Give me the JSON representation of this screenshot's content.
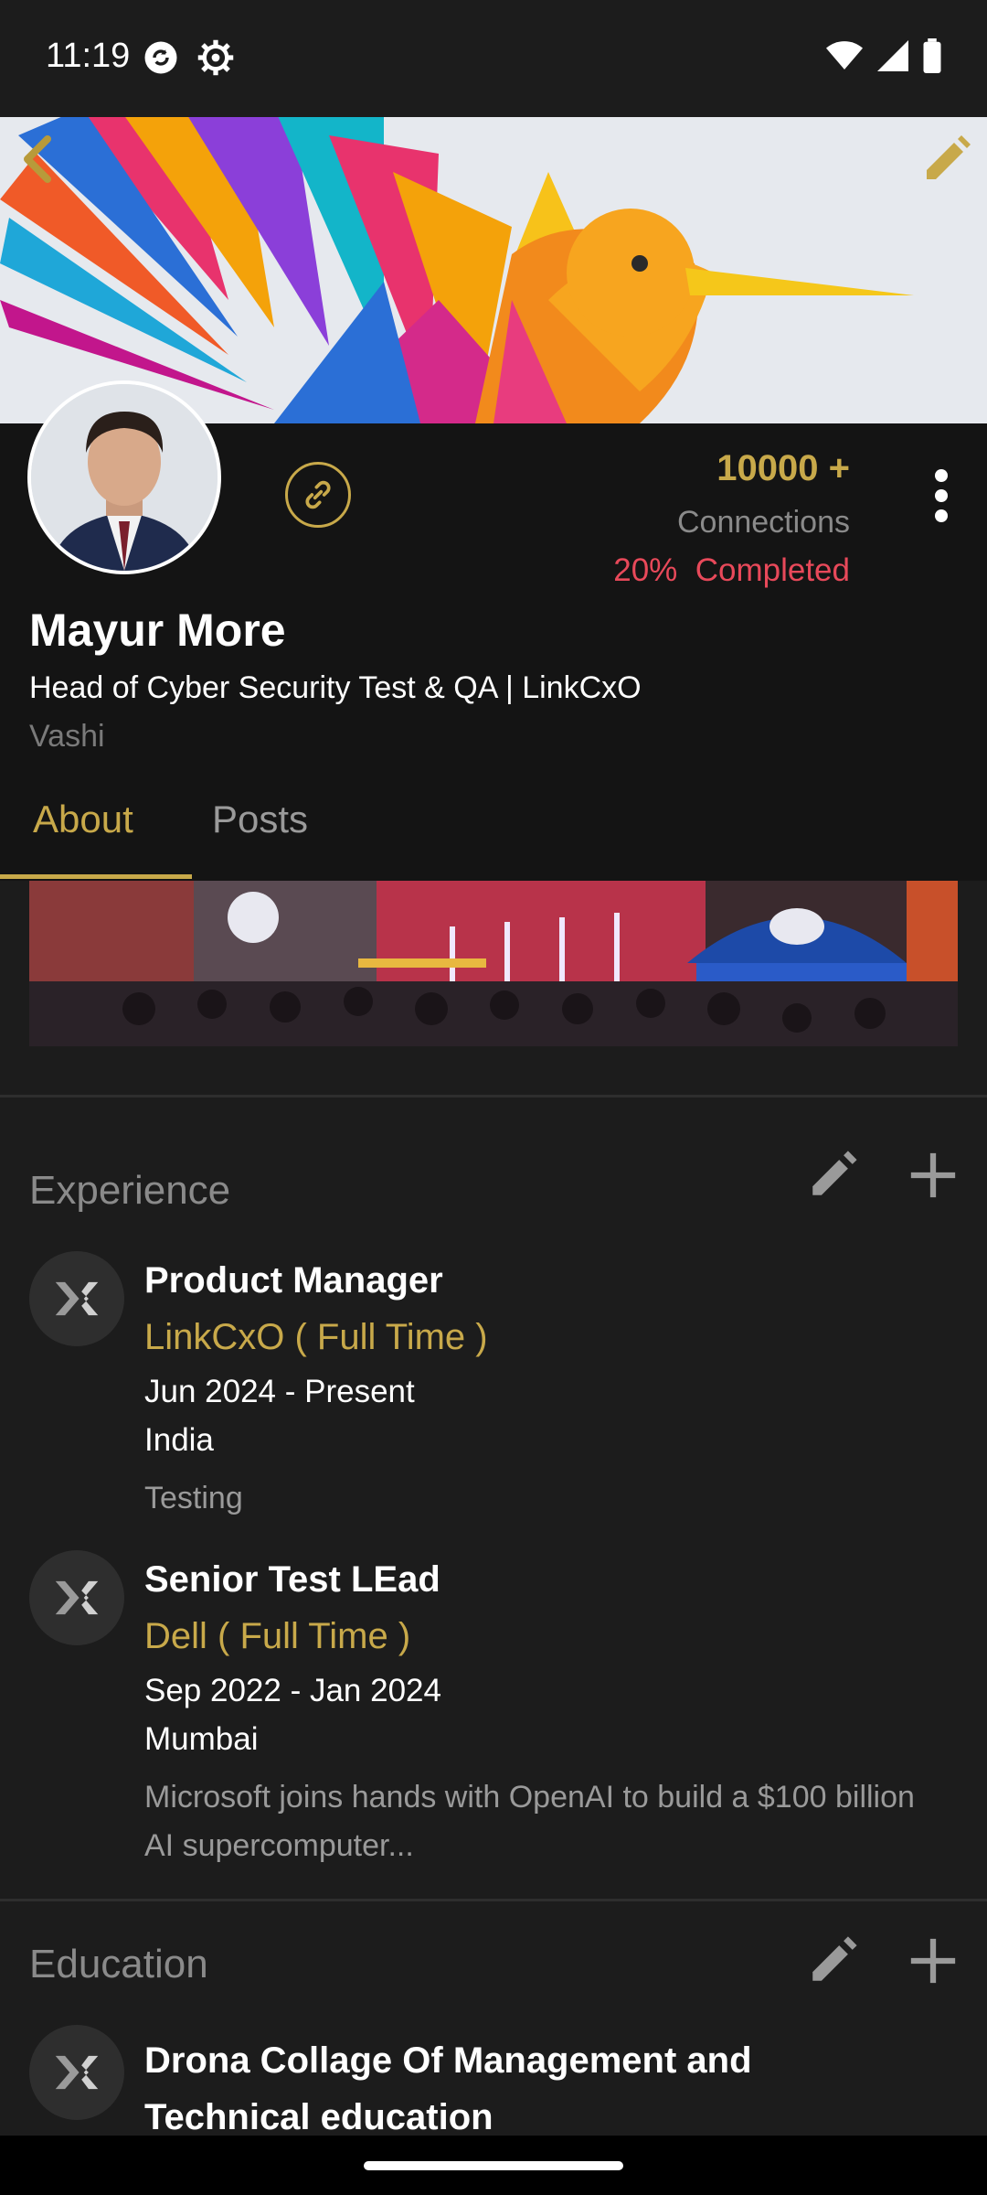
{
  "status_bar": {
    "time": "11:19"
  },
  "profile": {
    "connections_count": "10000 +",
    "connections_label": "Connections",
    "completion": "20%  Completed",
    "name": "Mayur More",
    "headline": "Head of Cyber Security Test & QA | LinkCxO",
    "location": "Vashi"
  },
  "tabs": [
    {
      "label": "About",
      "selected": true
    },
    {
      "label": "Posts",
      "selected": false
    }
  ],
  "experience": {
    "title": "Experience",
    "items": [
      {
        "role": "Product Manager",
        "company": "LinkCxO ( Full Time )",
        "dates": "Jun 2024 - Present",
        "location": "India",
        "description": "Testing"
      },
      {
        "role": "Senior Test LEad",
        "company": "Dell ( Full Time )",
        "dates": "Sep 2022 - Jan 2024",
        "location": "Mumbai",
        "description": "Microsoft joins hands with OpenAI to build a $100 billion AI supercomputer..."
      }
    ]
  },
  "education": {
    "title": "Education",
    "items": [
      {
        "institution": "Drona Collage Of Management and Technical education"
      }
    ]
  },
  "colors": {
    "accent": "#c8a94a",
    "completion_red": "#e8495a",
    "background": "#1c1c1c"
  },
  "icons": {
    "back": "chevron-left-icon",
    "edit": "pencil-icon",
    "link": "link-icon",
    "more": "more-vertical-icon",
    "add": "plus-icon",
    "company_logo": "linkcxo-logo-icon"
  }
}
